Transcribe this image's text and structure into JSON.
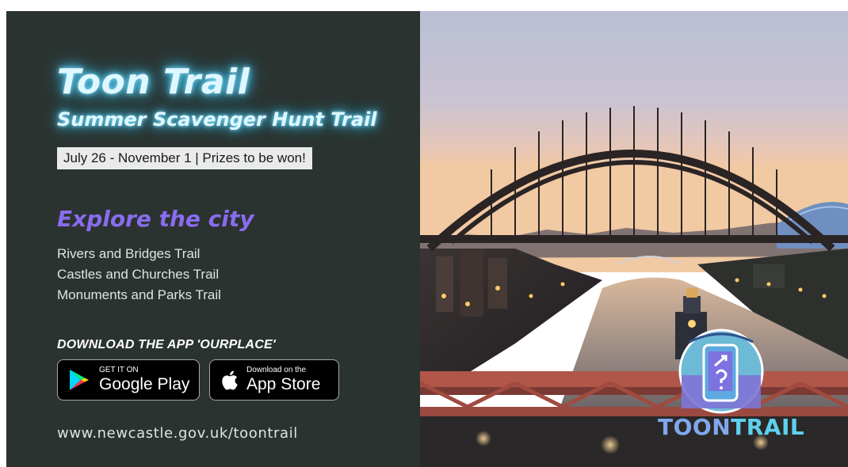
{
  "left": {
    "title": "Toon Trail",
    "subtitle": "Summer Scavenger Hunt Trail",
    "date_banner": "July 26 - November 1 | Prizes to be won!",
    "explore_heading": "Explore the city",
    "trails": [
      "Rivers and Bridges Trail",
      "Castles and Churches Trail",
      "Monuments and Parks Trail"
    ],
    "download_heading": "DOWNLOAD THE APP 'OURPLACE'",
    "google_play": {
      "small": "GET IT ON",
      "big": "Google Play"
    },
    "app_store": {
      "small": "Download on the",
      "big": "App Store"
    },
    "website": "www.newcastle.gov.uk/toontrail"
  },
  "logo": {
    "part1": "TOON",
    "part2": "TRAIL"
  },
  "colors": {
    "panel_bg": "#2b3330",
    "neon_title": "#dff8ff",
    "explore_purple": "#8a6cf0",
    "logo_blue": "#7fa8ec",
    "logo_cyan": "#5fd0ee"
  },
  "icons": {
    "google_play": "google-play-icon",
    "app_store": "apple-icon"
  }
}
